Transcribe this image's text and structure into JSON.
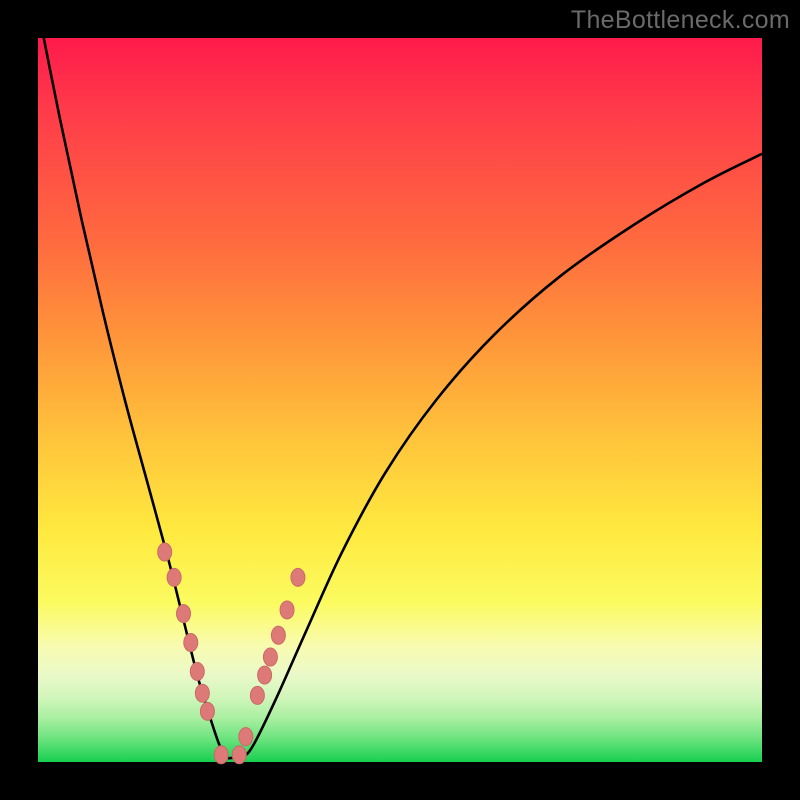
{
  "watermark": "TheBottleneck.com",
  "colors": {
    "frame": "#000000",
    "curve": "#000000",
    "marker_fill": "#dd7a77",
    "marker_stroke": "#c96a67"
  },
  "chart_data": {
    "type": "line",
    "title": "",
    "xlabel": "",
    "ylabel": "",
    "xlim": [
      0,
      100
    ],
    "ylim": [
      0,
      100
    ],
    "grid": false,
    "series": [
      {
        "name": "bottleneck-curve",
        "x": [
          0,
          3,
          6,
          9,
          12,
          15,
          18,
          20,
          22,
          23.5,
          25,
          26,
          27,
          28.5,
          30,
          33,
          37,
          42,
          48,
          55,
          63,
          72,
          82,
          92,
          100
        ],
        "values": [
          104,
          89,
          75,
          62,
          50,
          39,
          28,
          20,
          12,
          7,
          2.5,
          0.7,
          0.6,
          0.8,
          2.8,
          9,
          18,
          29,
          40,
          50,
          59,
          67,
          74,
          80,
          84
        ]
      }
    ],
    "markers": {
      "name": "curve-sample-points",
      "x": [
        17.5,
        18.8,
        20.1,
        21.1,
        22.0,
        22.7,
        23.4,
        25.3,
        27.8,
        28.7,
        30.3,
        31.3,
        32.1,
        33.2,
        34.4,
        35.9
      ],
      "values": [
        29,
        25.5,
        20.5,
        16.5,
        12.5,
        9.5,
        7.0,
        1.0,
        1.0,
        3.5,
        9.2,
        12.0,
        14.5,
        17.5,
        21.0,
        25.5
      ],
      "rx": 7,
      "ry": 9
    }
  }
}
